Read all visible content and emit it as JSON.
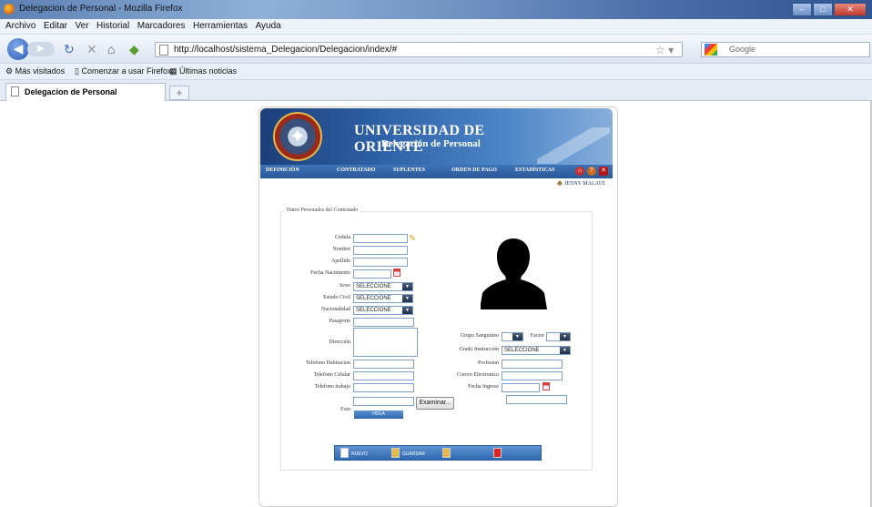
{
  "browser": {
    "window_title": "Delegacion de Personal - Mozilla Firefox",
    "menu": [
      "Archivo",
      "Editar",
      "Ver",
      "Historial",
      "Marcadores",
      "Herramientas",
      "Ayuda"
    ],
    "url": "http://localhost/sistema_Delegacion/Delegacion/index/#",
    "search_placeholder": "Google",
    "bookmarks": [
      "Más visitados",
      "Comenzar a usar Firefox",
      "Últimas noticias"
    ],
    "tab_title": "Delegacion de Personal",
    "newtab_label": "+"
  },
  "app": {
    "title": "UNIVERSIDAD DE ORIENTE",
    "subtitle": "Delegación de Personal",
    "nav": [
      "DEFINICIÓN",
      "CONTRATADO",
      "SUPLENTES",
      "ORDEN DE PAGO",
      "ESTADÍSTICAS"
    ],
    "user": "JENNY MALAVE"
  },
  "form": {
    "legend": "Datos Personales del Contratado",
    "labels": {
      "cedula": "Cedula",
      "nombre": "Nombre",
      "apellido": "Apellido",
      "fecha_nac": "Fecha Nacimiento",
      "sexo": "Sexo",
      "estado_civil": "Estado Civil",
      "nacionalidad": "Nacionalidad",
      "pasaporte": "Pasaporte",
      "direccion": "Dirección",
      "tel_hab": "Telefono Habitacion",
      "tel_cel": "Telefono Celular",
      "tel_trab": "Telefono trabajo",
      "foto": "Foto",
      "grupo_sang": "Grupo Sanguineo",
      "factor": "Factor",
      "grado_instr": "Grado Instrucción",
      "profesion": "Profesion",
      "correo": "Correo Electronico",
      "fecha_ing": "Fecha Ingreso"
    },
    "select_default": "SELECCIONE",
    "examinar": "Examinar...",
    "hola": "HOLA"
  },
  "actions": [
    "NUEVO",
    "GUARDAR",
    "",
    ""
  ]
}
